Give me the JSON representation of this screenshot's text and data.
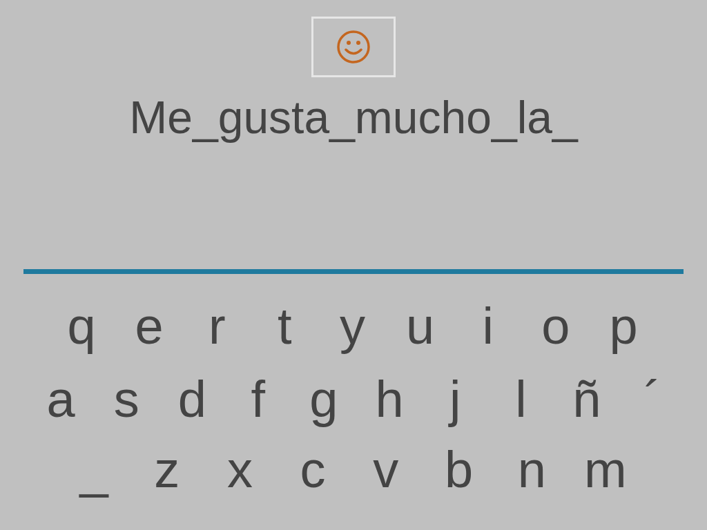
{
  "sentence": "Me_gusta_mucho_la_",
  "keyboard": {
    "rows": [
      [
        "q",
        "e",
        "r",
        "t",
        "y",
        "u",
        "i",
        "o",
        "p"
      ],
      [
        "a",
        "s",
        "d",
        "f",
        "g",
        "h",
        "j",
        "l",
        "ñ",
        "´"
      ],
      [
        "_",
        "z",
        "x",
        "c",
        "v",
        "b",
        "n",
        "m"
      ]
    ]
  }
}
